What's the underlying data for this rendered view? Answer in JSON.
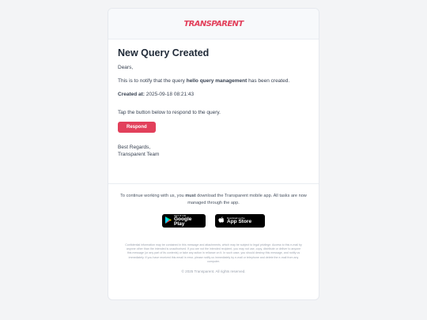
{
  "brand": {
    "logo_text": "TRANSPARENT",
    "accent": "#e2405b"
  },
  "email": {
    "title": "New Query Created",
    "greeting": "Dears,",
    "intro_prefix": "This is to notify that the query ",
    "query_name": "hello query management",
    "intro_suffix": " has been created.",
    "created_label": "Created at:",
    "created_value": "2025-09-18 08:21:43",
    "cta_prompt": "Tap the button below to respond to the query.",
    "respond_label": "Respond",
    "signoff": "Best Regards,",
    "team": "Transparent Team"
  },
  "footer": {
    "notice_prefix": "To continue working with us, you ",
    "notice_must": "must",
    "notice_suffix": " download the Transparent mobile app. All tasks are now managed through the app.",
    "google_play": {
      "small": "GET IT ON",
      "big": "Google Play",
      "icon": "play-icon"
    },
    "app_store": {
      "small": "Download on the",
      "big": "App Store",
      "icon": "apple-icon"
    },
    "legal": "Confidential information may be contained in this message and attachments, which may be subject to legal privilege. Access to this e-mail by anyone other than the intended is unauthorised. If you are not the intended recipient, you may not use, copy, distribute or deliver to anyone this message (or any part of its contents) or take any action in reliance on it. In such case, you should destroy this message, and notify us immediately. If you have received this email in error, please notify us immediately by e-mail or telephone and delete the e-mail from any computer.",
    "copyright": "© 2025 Transparent. All rights reserved."
  }
}
